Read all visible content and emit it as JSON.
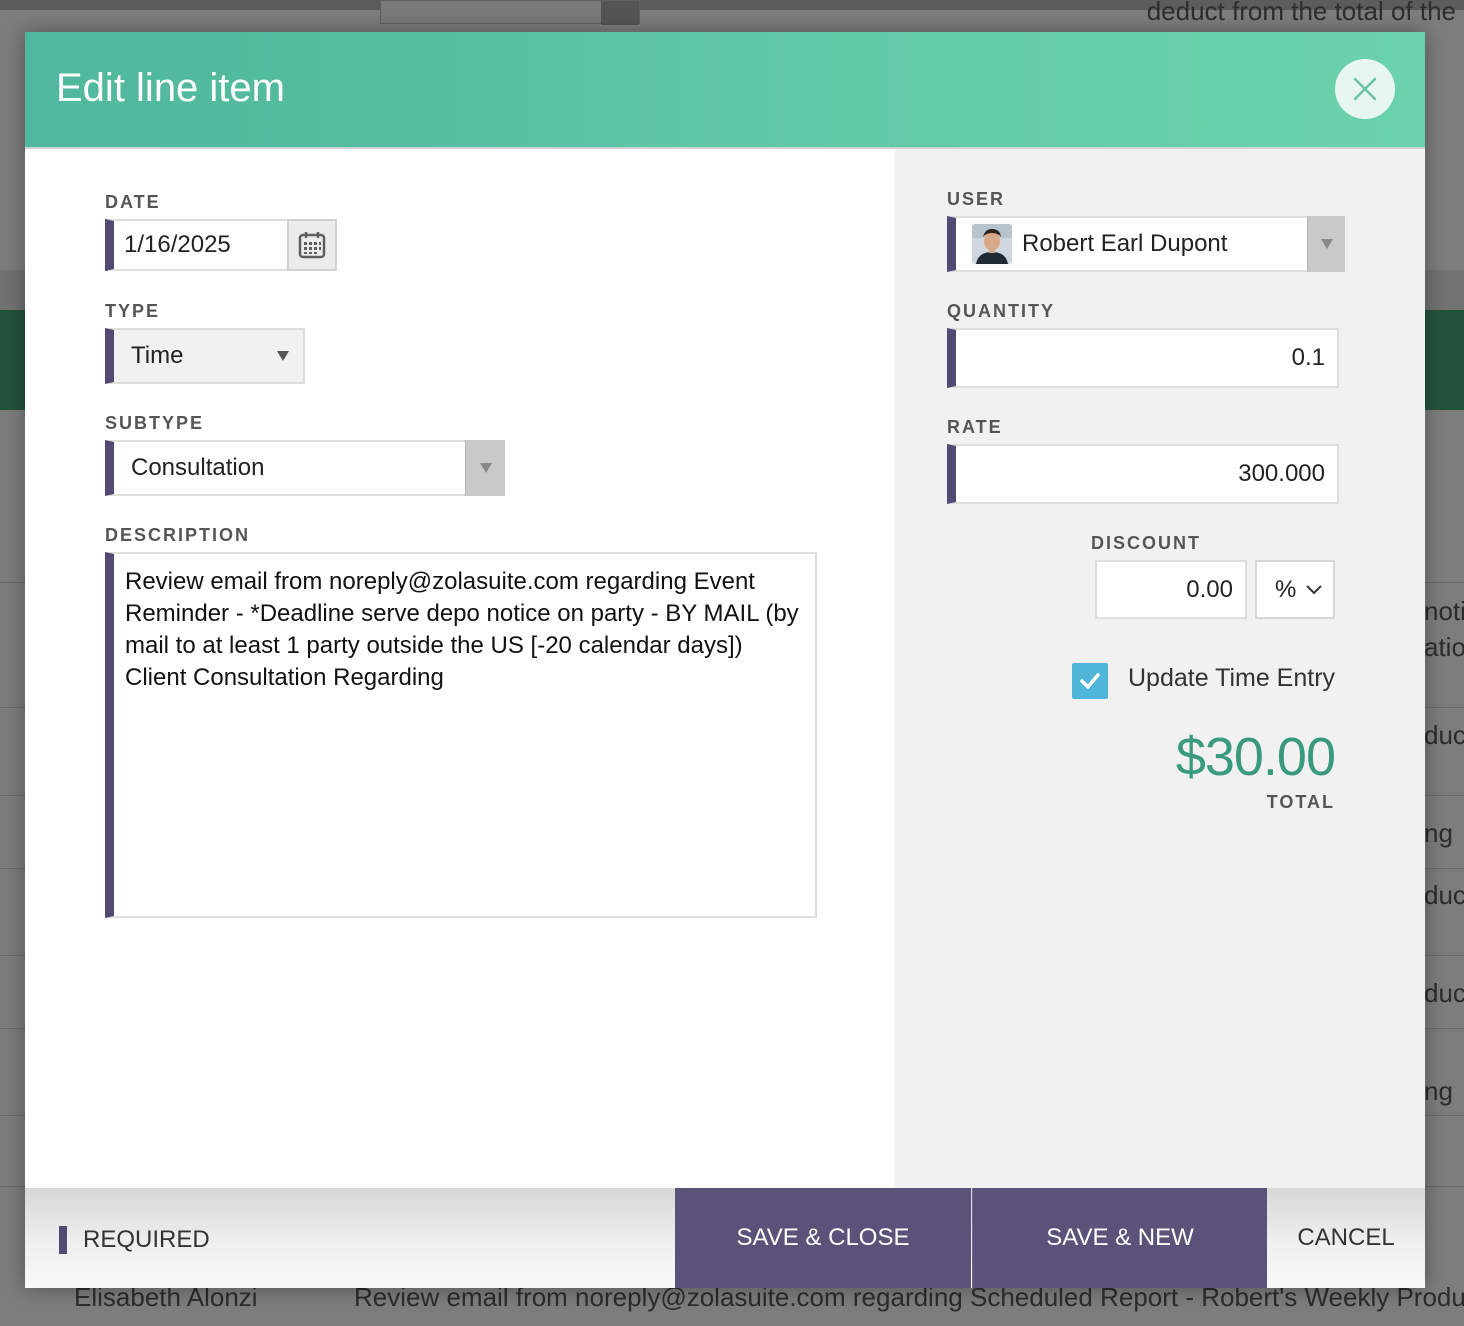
{
  "background": {
    "top_text": "deduct from the total of the",
    "row_fragments": [
      "notic",
      "ation",
      "duc",
      "ng",
      "duc",
      "duc",
      "ng"
    ],
    "bottom_row": {
      "name": "Elisabeth Alonzi",
      "description": "Review email from noreply@zolasuite.com regarding Scheduled Report - Robert's Weekly Produc"
    }
  },
  "modal": {
    "title": "Edit line item",
    "close_icon": "close-icon"
  },
  "form": {
    "date": {
      "label": "DATE",
      "value": "1/16/2025",
      "icon": "calendar-icon"
    },
    "type": {
      "label": "TYPE",
      "value": "Time"
    },
    "subtype": {
      "label": "SUBTYPE",
      "value": "Consultation"
    },
    "description": {
      "label": "DESCRIPTION",
      "value": "Review email from noreply@zolasuite.com regarding Event Reminder - *Deadline serve depo notice on party - BY MAIL (by mail to at least 1 party outside the US [-20 calendar days]) Client Consultation Regarding"
    },
    "user": {
      "label": "USER",
      "value": "Robert Earl Dupont"
    },
    "quantity": {
      "label": "QUANTITY",
      "value": "0.1"
    },
    "rate": {
      "label": "RATE",
      "value": "300.000"
    },
    "discount": {
      "label": "DISCOUNT",
      "value": "0.00",
      "unit": "%"
    },
    "update_time_entry": {
      "label": "Update Time Entry",
      "checked": true
    },
    "total": {
      "amount": "$30.00",
      "label": "TOTAL"
    }
  },
  "footer": {
    "required_label": "REQUIRED",
    "save_close_label": "SAVE & CLOSE",
    "save_new_label": "SAVE & NEW",
    "cancel_label": "CANCEL"
  },
  "colors": {
    "header_start": "#4fb89e",
    "header_end": "#6bd2ad",
    "accent_purple": "#534a74",
    "button_purple": "#5b5279",
    "total_green": "#3a9a7d",
    "checkbox_blue": "#4fb6d9"
  }
}
